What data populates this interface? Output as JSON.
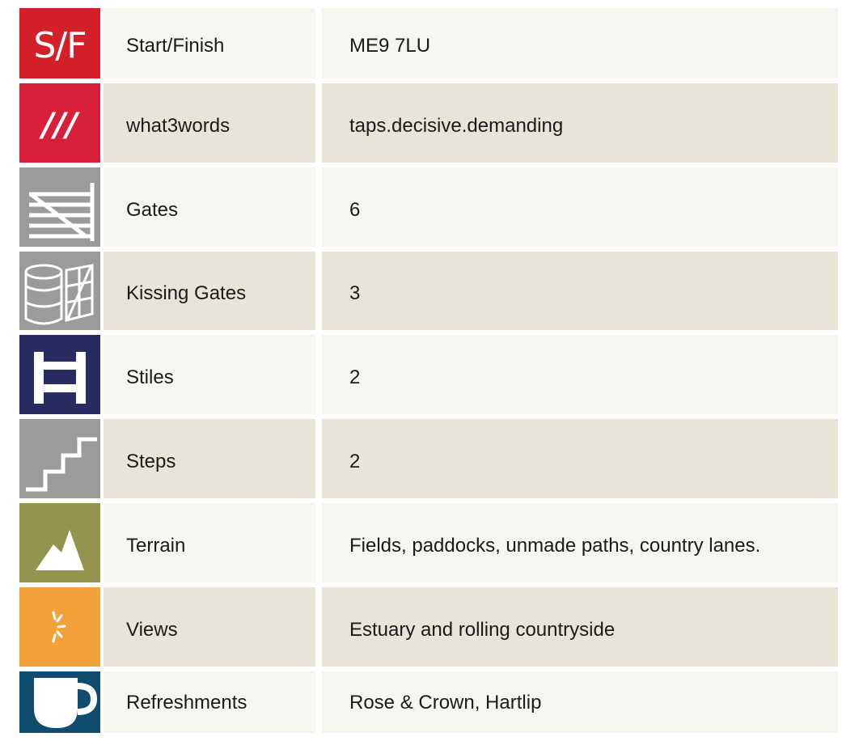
{
  "rows": [
    {
      "key": "start",
      "icon": "start-finish-icon",
      "icon_text": "S/F",
      "icon_bg": "#d42028",
      "label": "Start/Finish",
      "value": "ME9 7LU"
    },
    {
      "key": "what3words",
      "icon": "what3words-icon",
      "icon_text": "///",
      "icon_bg": "#d8203b",
      "label": "what3words",
      "value": "taps.decisive.demanding"
    },
    {
      "key": "gates",
      "icon": "gate-icon",
      "icon_bg": "#9b9b9b",
      "label": "Gates",
      "value": "6"
    },
    {
      "key": "kissing",
      "icon": "kissing-gate-icon",
      "icon_bg": "#9b9b9b",
      "label": "Kissing Gates",
      "value": "3"
    },
    {
      "key": "stiles",
      "icon": "stile-icon",
      "icon_bg": "#292c60",
      "label": "Stiles",
      "value": "2"
    },
    {
      "key": "steps",
      "icon": "steps-icon",
      "icon_bg": "#9b9b9b",
      "label": "Steps",
      "value": "2"
    },
    {
      "key": "terrain",
      "icon": "terrain-icon",
      "icon_bg": "#93944e",
      "label": "Terrain",
      "value": "Fields, paddocks, unmade paths, country lanes."
    },
    {
      "key": "views",
      "icon": "views-icon",
      "icon_bg": "#f3a23a",
      "label": "Views",
      "value": "Estuary and rolling countryside"
    },
    {
      "key": "refreshments",
      "icon": "cup-icon",
      "icon_bg": "#0f4d6e",
      "label": "Refreshments",
      "value": "Rose & Crown, Hartlip"
    }
  ]
}
